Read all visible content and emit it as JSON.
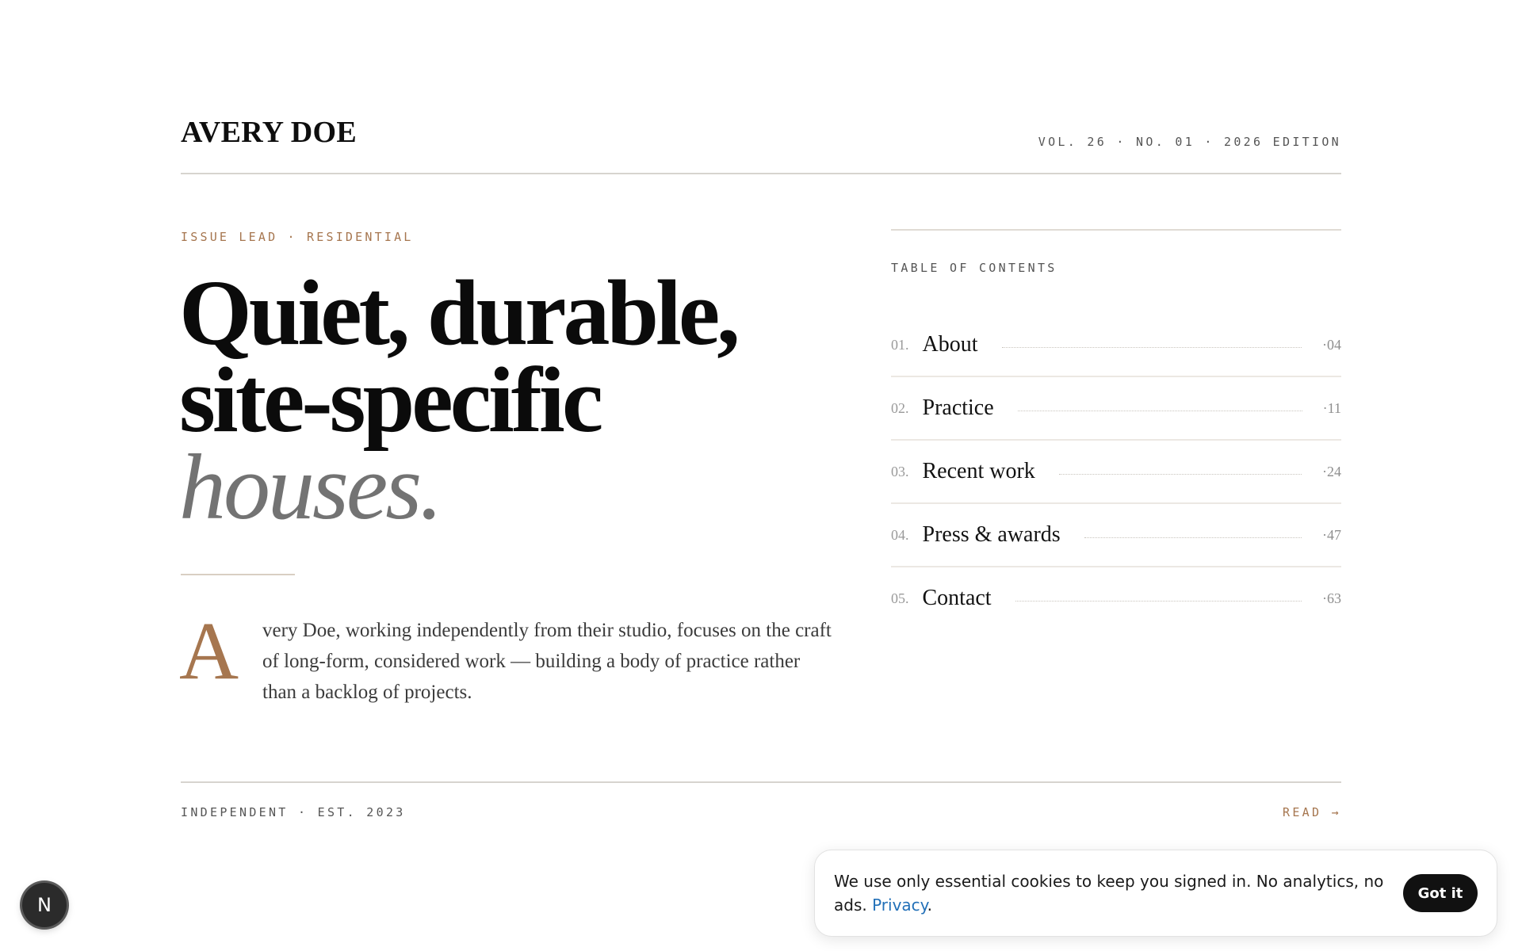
{
  "header": {
    "brand": "AVERY DOE",
    "edition": "VOL. 26 · NO. 01 · 2026 EDITION"
  },
  "lead": {
    "kicker": "ISSUE LEAD · RESIDENTIAL",
    "headline_line1": "Quiet, durable,",
    "headline_line2": "site-specific",
    "headline_emphasis": "houses.",
    "dropcap": "A",
    "intro": "very Doe, working independently from their studio, focuses on the craft of long-form, considered work — building a body of practice rather than a backlog of projects."
  },
  "toc": {
    "title": "TABLE OF CONTENTS",
    "items": [
      {
        "number": "01.",
        "label": "About",
        "page": "·04"
      },
      {
        "number": "02.",
        "label": "Practice",
        "page": "·11"
      },
      {
        "number": "03.",
        "label": "Recent work",
        "page": "·24"
      },
      {
        "number": "04.",
        "label": "Press & awards",
        "page": "·47"
      },
      {
        "number": "05.",
        "label": "Contact",
        "page": "·63"
      }
    ]
  },
  "footer": {
    "left": "INDEPENDENT · EST. 2023",
    "right": "READ →"
  },
  "badge": {
    "letter": "N"
  },
  "cookie": {
    "message": "We use only essential cookies to keep you signed in. No analytics, no ads.",
    "link_label": "Privacy",
    "link_suffix": ".",
    "button_label": "Got it"
  },
  "colors": {
    "accent": "#a6764f",
    "ink": "#0b0b0b",
    "muted": "#737373",
    "link": "#2270b8"
  }
}
